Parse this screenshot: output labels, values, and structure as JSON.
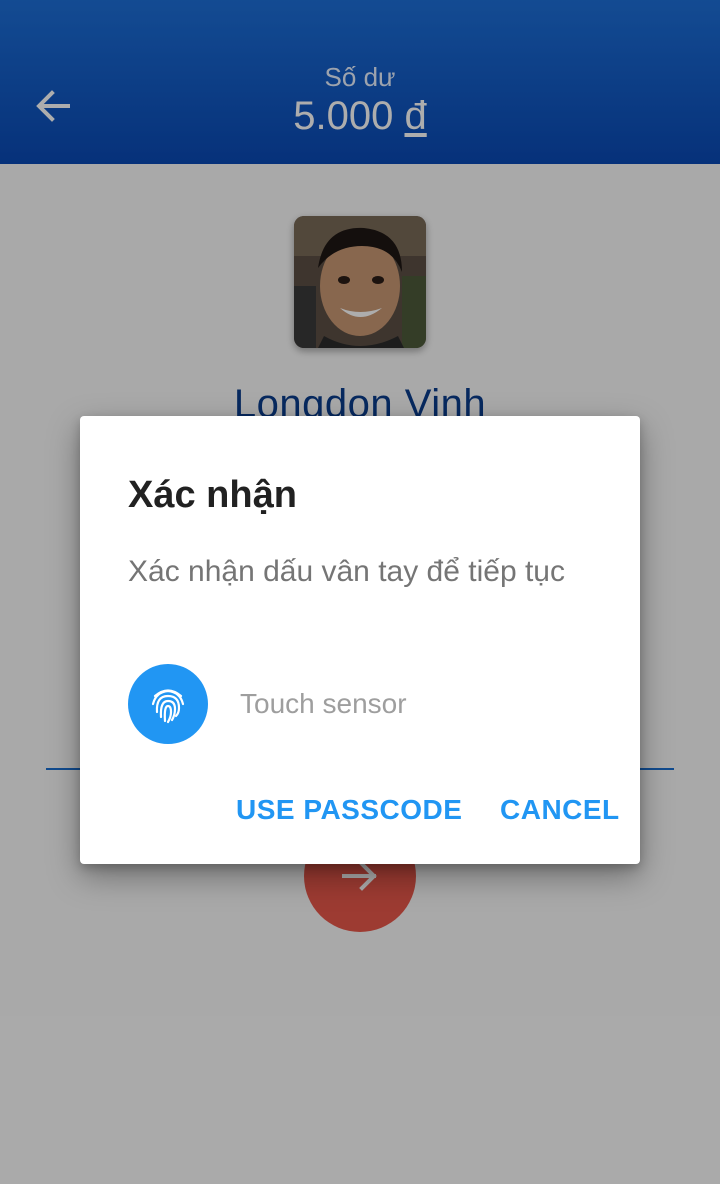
{
  "header": {
    "caption": "Số dư",
    "balance": "5.000",
    "currency": "đ"
  },
  "profile": {
    "name": "Longdon Vinh"
  },
  "dialog": {
    "title": "Xác nhận",
    "message": "Xác nhận dấu vân tay để tiếp tục",
    "sensor_status": "Touch sensor",
    "passcode_label": "USE PASSCODE",
    "cancel_label": "CANCEL"
  },
  "colors": {
    "header_top": "#1d6fd8",
    "header_bottom": "#0a49b4",
    "name_text": "#0b3d8c",
    "fab": "#e8574b",
    "accent": "#2196f3"
  },
  "icons": {
    "back": "arrow-left-icon",
    "fingerprint": "fingerprint-icon",
    "next": "arrow-right-icon"
  }
}
